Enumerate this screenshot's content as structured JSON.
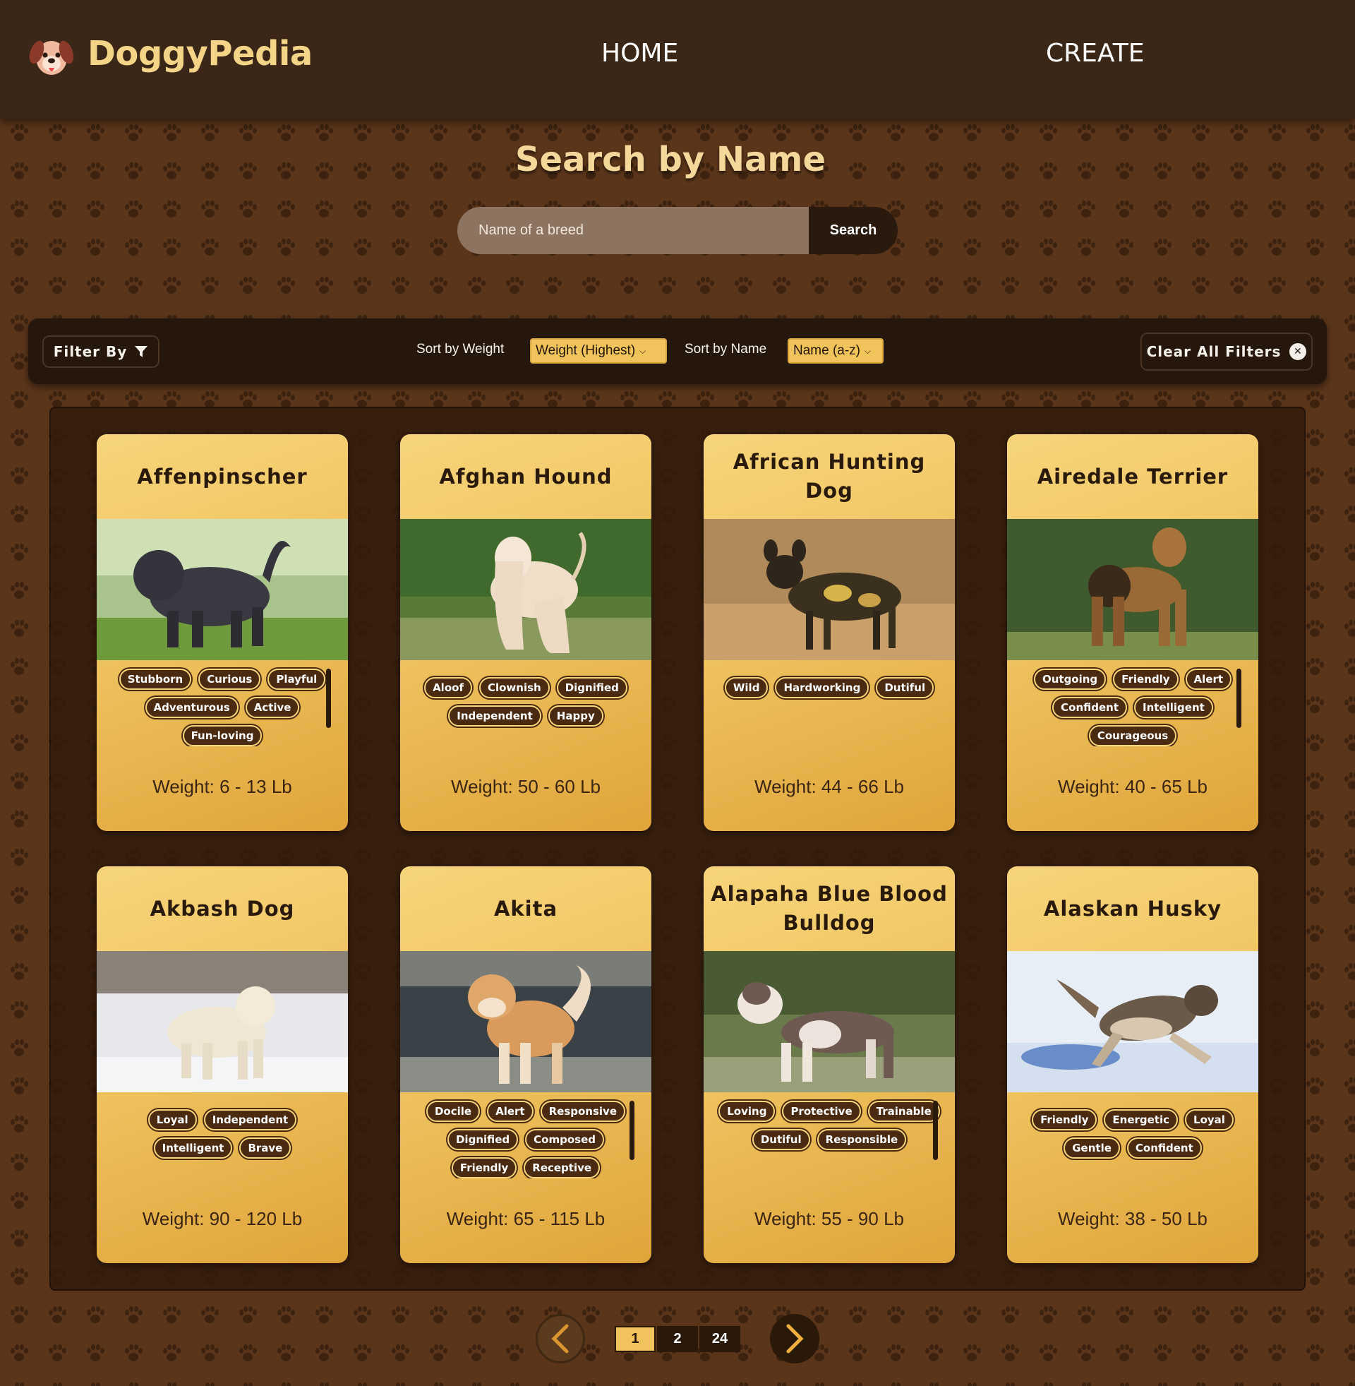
{
  "navbar": {
    "brand": "DoggyPedia",
    "links": {
      "home": "HOME",
      "create": "CREATE"
    }
  },
  "search": {
    "title": "Search by Name",
    "placeholder": "Name of a breed",
    "button_label": "Search"
  },
  "filters": {
    "filter_by_label": "Filter By",
    "sort_weight_label": "Sort by Weight",
    "sort_weight_value": "Weight (Highest)",
    "sort_name_label": "Sort by Name",
    "sort_name_value": "Name (a-z)",
    "clear_label": "Clear All Filters"
  },
  "colors": {
    "accent": "#f0c45a",
    "navbar": "#3b2717",
    "background": "#5a351a"
  },
  "cards": [
    {
      "name": "Affenpinscher",
      "temperaments": [
        "Stubborn",
        "Curious",
        "Playful",
        "Adventurous",
        "Active",
        "Fun-loving"
      ],
      "weight": "Weight: 6 - 13 Lb"
    },
    {
      "name": "Afghan Hound",
      "temperaments": [
        "Aloof",
        "Clownish",
        "Dignified",
        "Independent",
        "Happy"
      ],
      "weight": "Weight: 50 - 60 Lb"
    },
    {
      "name": "African Hunting Dog",
      "temperaments": [
        "Wild",
        "Hardworking",
        "Dutiful"
      ],
      "weight": "Weight: 44 - 66 Lb"
    },
    {
      "name": "Airedale Terrier",
      "temperaments": [
        "Outgoing",
        "Friendly",
        "Alert",
        "Confident",
        "Intelligent",
        "Courageous"
      ],
      "weight": "Weight: 40 - 65 Lb"
    },
    {
      "name": "Akbash Dog",
      "temperaments": [
        "Loyal",
        "Independent",
        "Intelligent",
        "Brave"
      ],
      "weight": "Weight: 90 - 120 Lb"
    },
    {
      "name": "Akita",
      "temperaments": [
        "Docile",
        "Alert",
        "Responsive",
        "Dignified",
        "Composed",
        "Friendly",
        "Receptive"
      ],
      "weight": "Weight: 65 - 115 Lb"
    },
    {
      "name": "Alapaha Blue Blood Bulldog",
      "temperaments": [
        "Loving",
        "Protective",
        "Trainable",
        "Dutiful",
        "Responsible"
      ],
      "weight": "Weight: 55 - 90 Lb"
    },
    {
      "name": "Alaskan Husky",
      "temperaments": [
        "Friendly",
        "Energetic",
        "Loyal",
        "Gentle",
        "Confident"
      ],
      "weight": "Weight: 38 - 50 Lb"
    }
  ],
  "pagination": {
    "pages": [
      "1",
      "2",
      "24"
    ],
    "current": "1"
  }
}
